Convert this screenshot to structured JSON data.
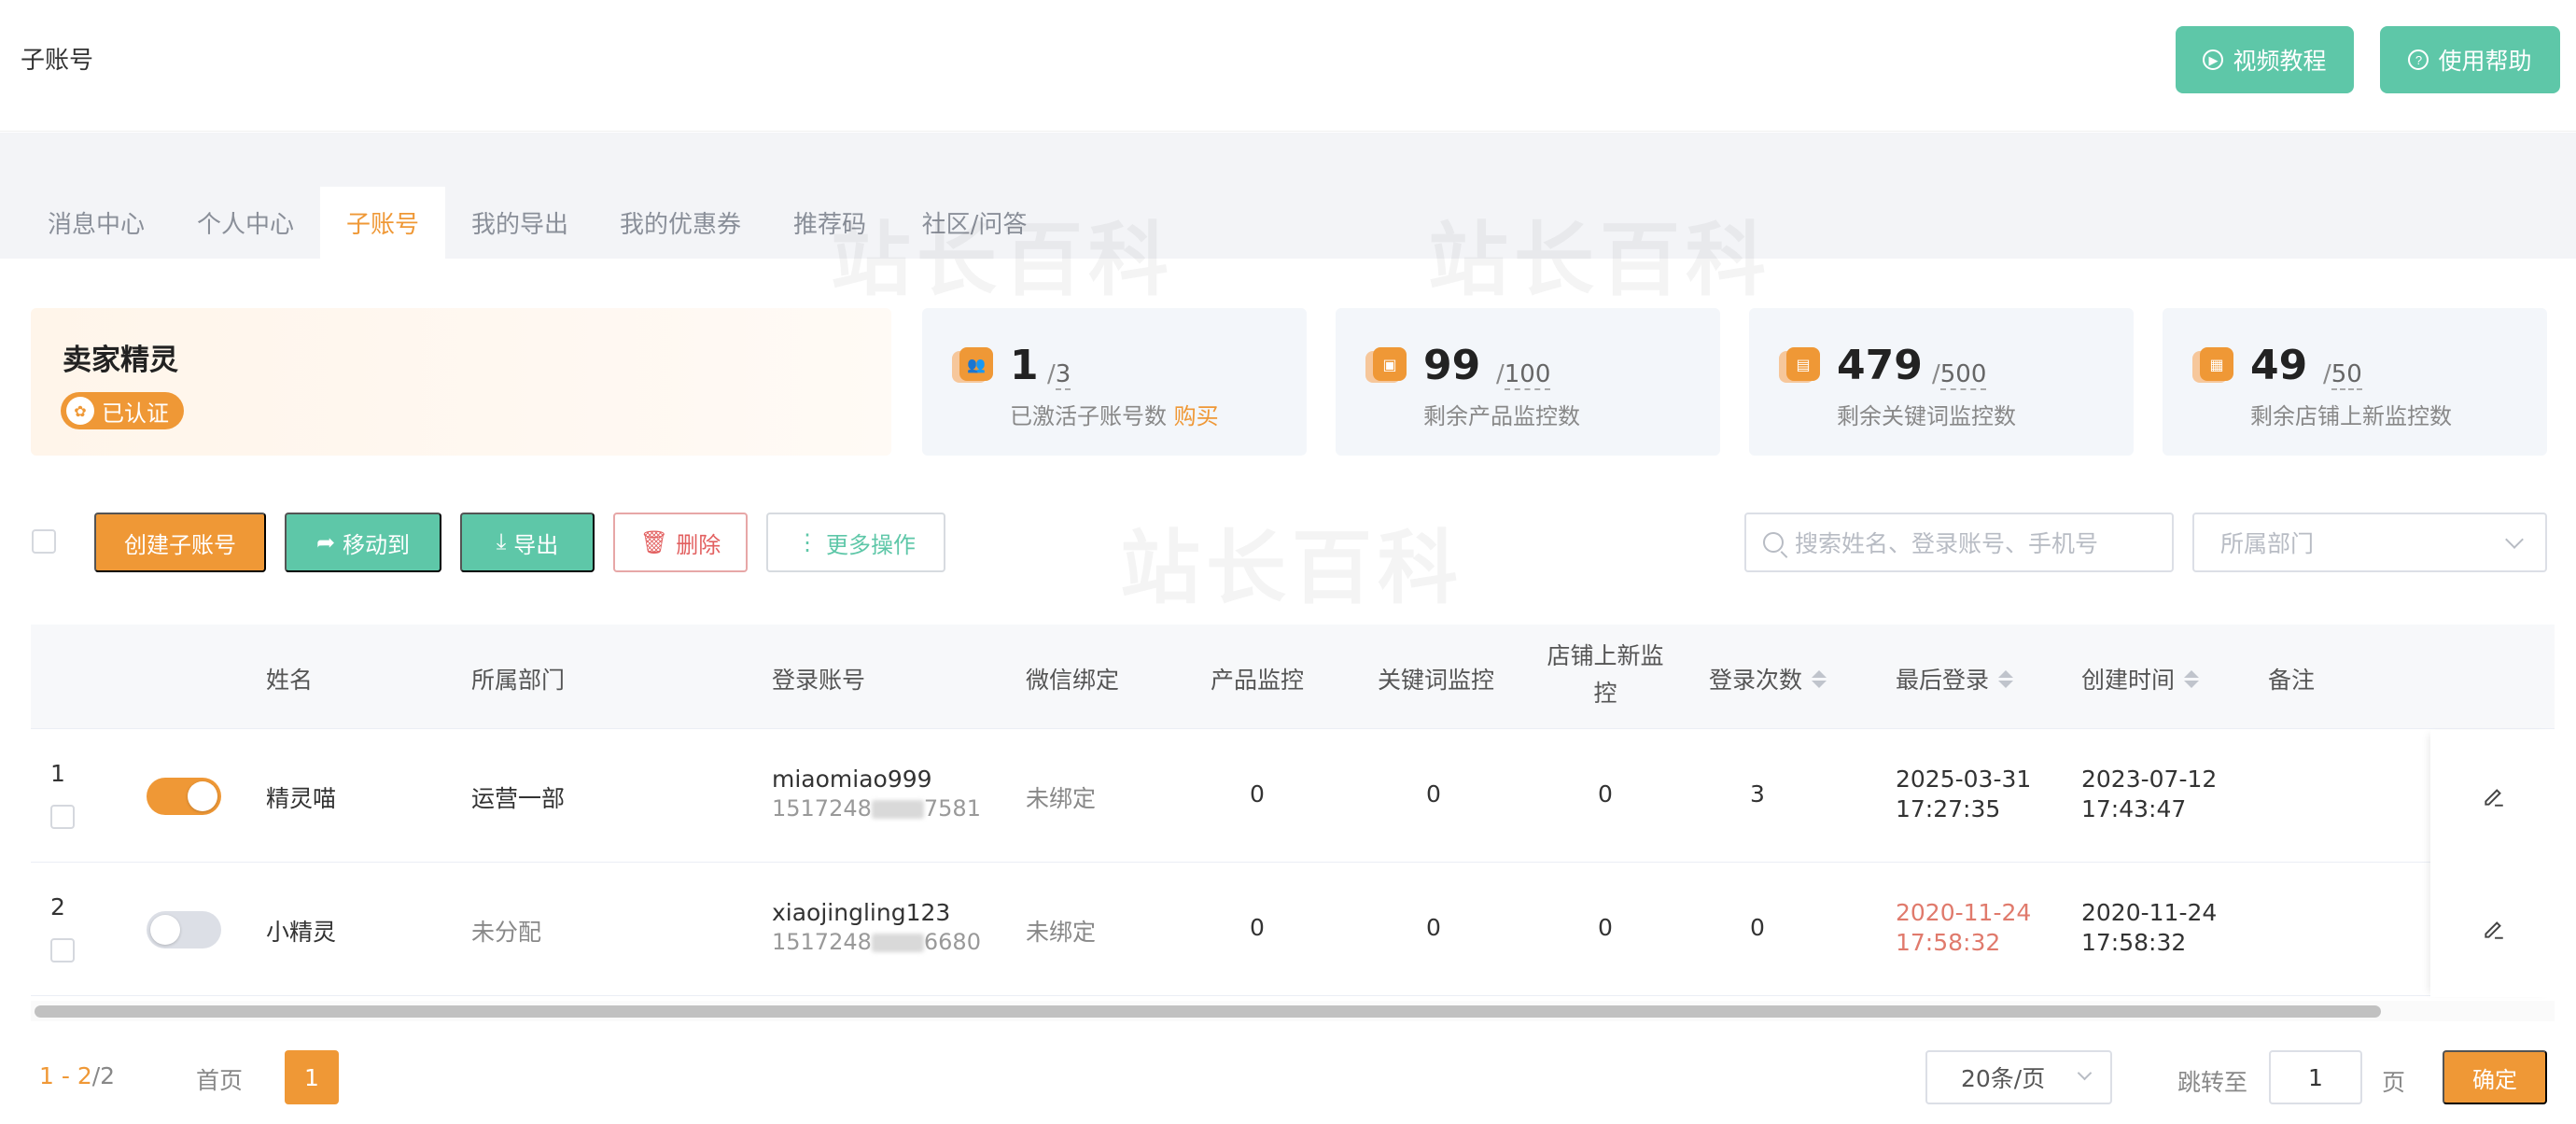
{
  "header": {
    "title": "子账号",
    "video_btn": "视频教程",
    "help_btn": "使用帮助"
  },
  "tabs": [
    "消息中心",
    "个人中心",
    "子账号",
    "我的导出",
    "我的优惠券",
    "推荐码",
    "社区/问答"
  ],
  "active_tab": "子账号",
  "watermark": "站长百科",
  "account": {
    "name": "卖家精灵",
    "badge": "已认证"
  },
  "stats": [
    {
      "value": "1",
      "total": "3",
      "label": "已激活子账号数",
      "action": "购买"
    },
    {
      "value": "99",
      "total": "100",
      "label": "剩余产品监控数"
    },
    {
      "value": "479",
      "total": "500",
      "label": "剩余关键词监控数"
    },
    {
      "value": "49",
      "total": "50",
      "label": "剩余店铺上新监控数"
    }
  ],
  "toolbar": {
    "create": "创建子账号",
    "move": "移动到",
    "export": "导出",
    "delete": "删除",
    "more": "更多操作",
    "search_placeholder": "搜索姓名、登录账号、手机号",
    "dept_placeholder": "所属部门"
  },
  "columns": {
    "name": "姓名",
    "dept": "所属部门",
    "account": "登录账号",
    "wechat": "微信绑定",
    "product": "产品监控",
    "keyword": "关键词监控",
    "store_1": "店铺上新监",
    "store_2": "控",
    "logins": "登录次数",
    "last_login": "最后登录",
    "created": "创建时间",
    "remark": "备注"
  },
  "rows": [
    {
      "index": "1",
      "enabled": true,
      "name": "精灵喵",
      "dept": "运营一部",
      "account": "miaomiao999",
      "phone_prefix": "1517248",
      "phone_suffix": "7581",
      "wechat": "未绑定",
      "product": "0",
      "keyword": "0",
      "store": "0",
      "logins": "3",
      "last_login_date": "2025-03-31",
      "last_login_time": "17:27:35",
      "created_date": "2023-07-12",
      "created_time": "17:43:47"
    },
    {
      "index": "2",
      "enabled": false,
      "name": "小精灵",
      "dept": "未分配",
      "account": "xiaojingling123",
      "phone_prefix": "1517248",
      "phone_suffix": "6680",
      "wechat": "未绑定",
      "product": "0",
      "keyword": "0",
      "store": "0",
      "logins": "0",
      "last_login_date": "2020-11-24",
      "last_login_time": "17:58:32",
      "created_date": "2020-11-24",
      "created_time": "17:58:32"
    }
  ],
  "pagination": {
    "range": "1 - 2",
    "total": "/2",
    "first": "首页",
    "current": "1",
    "page_size": "20条/页",
    "jump_label": "跳转至",
    "jump_value": "1",
    "unit": "页",
    "confirm": "确定"
  },
  "colors": {
    "accent_orange": "#ef9836",
    "accent_green": "#5ec7a8",
    "danger": "#e26060"
  }
}
